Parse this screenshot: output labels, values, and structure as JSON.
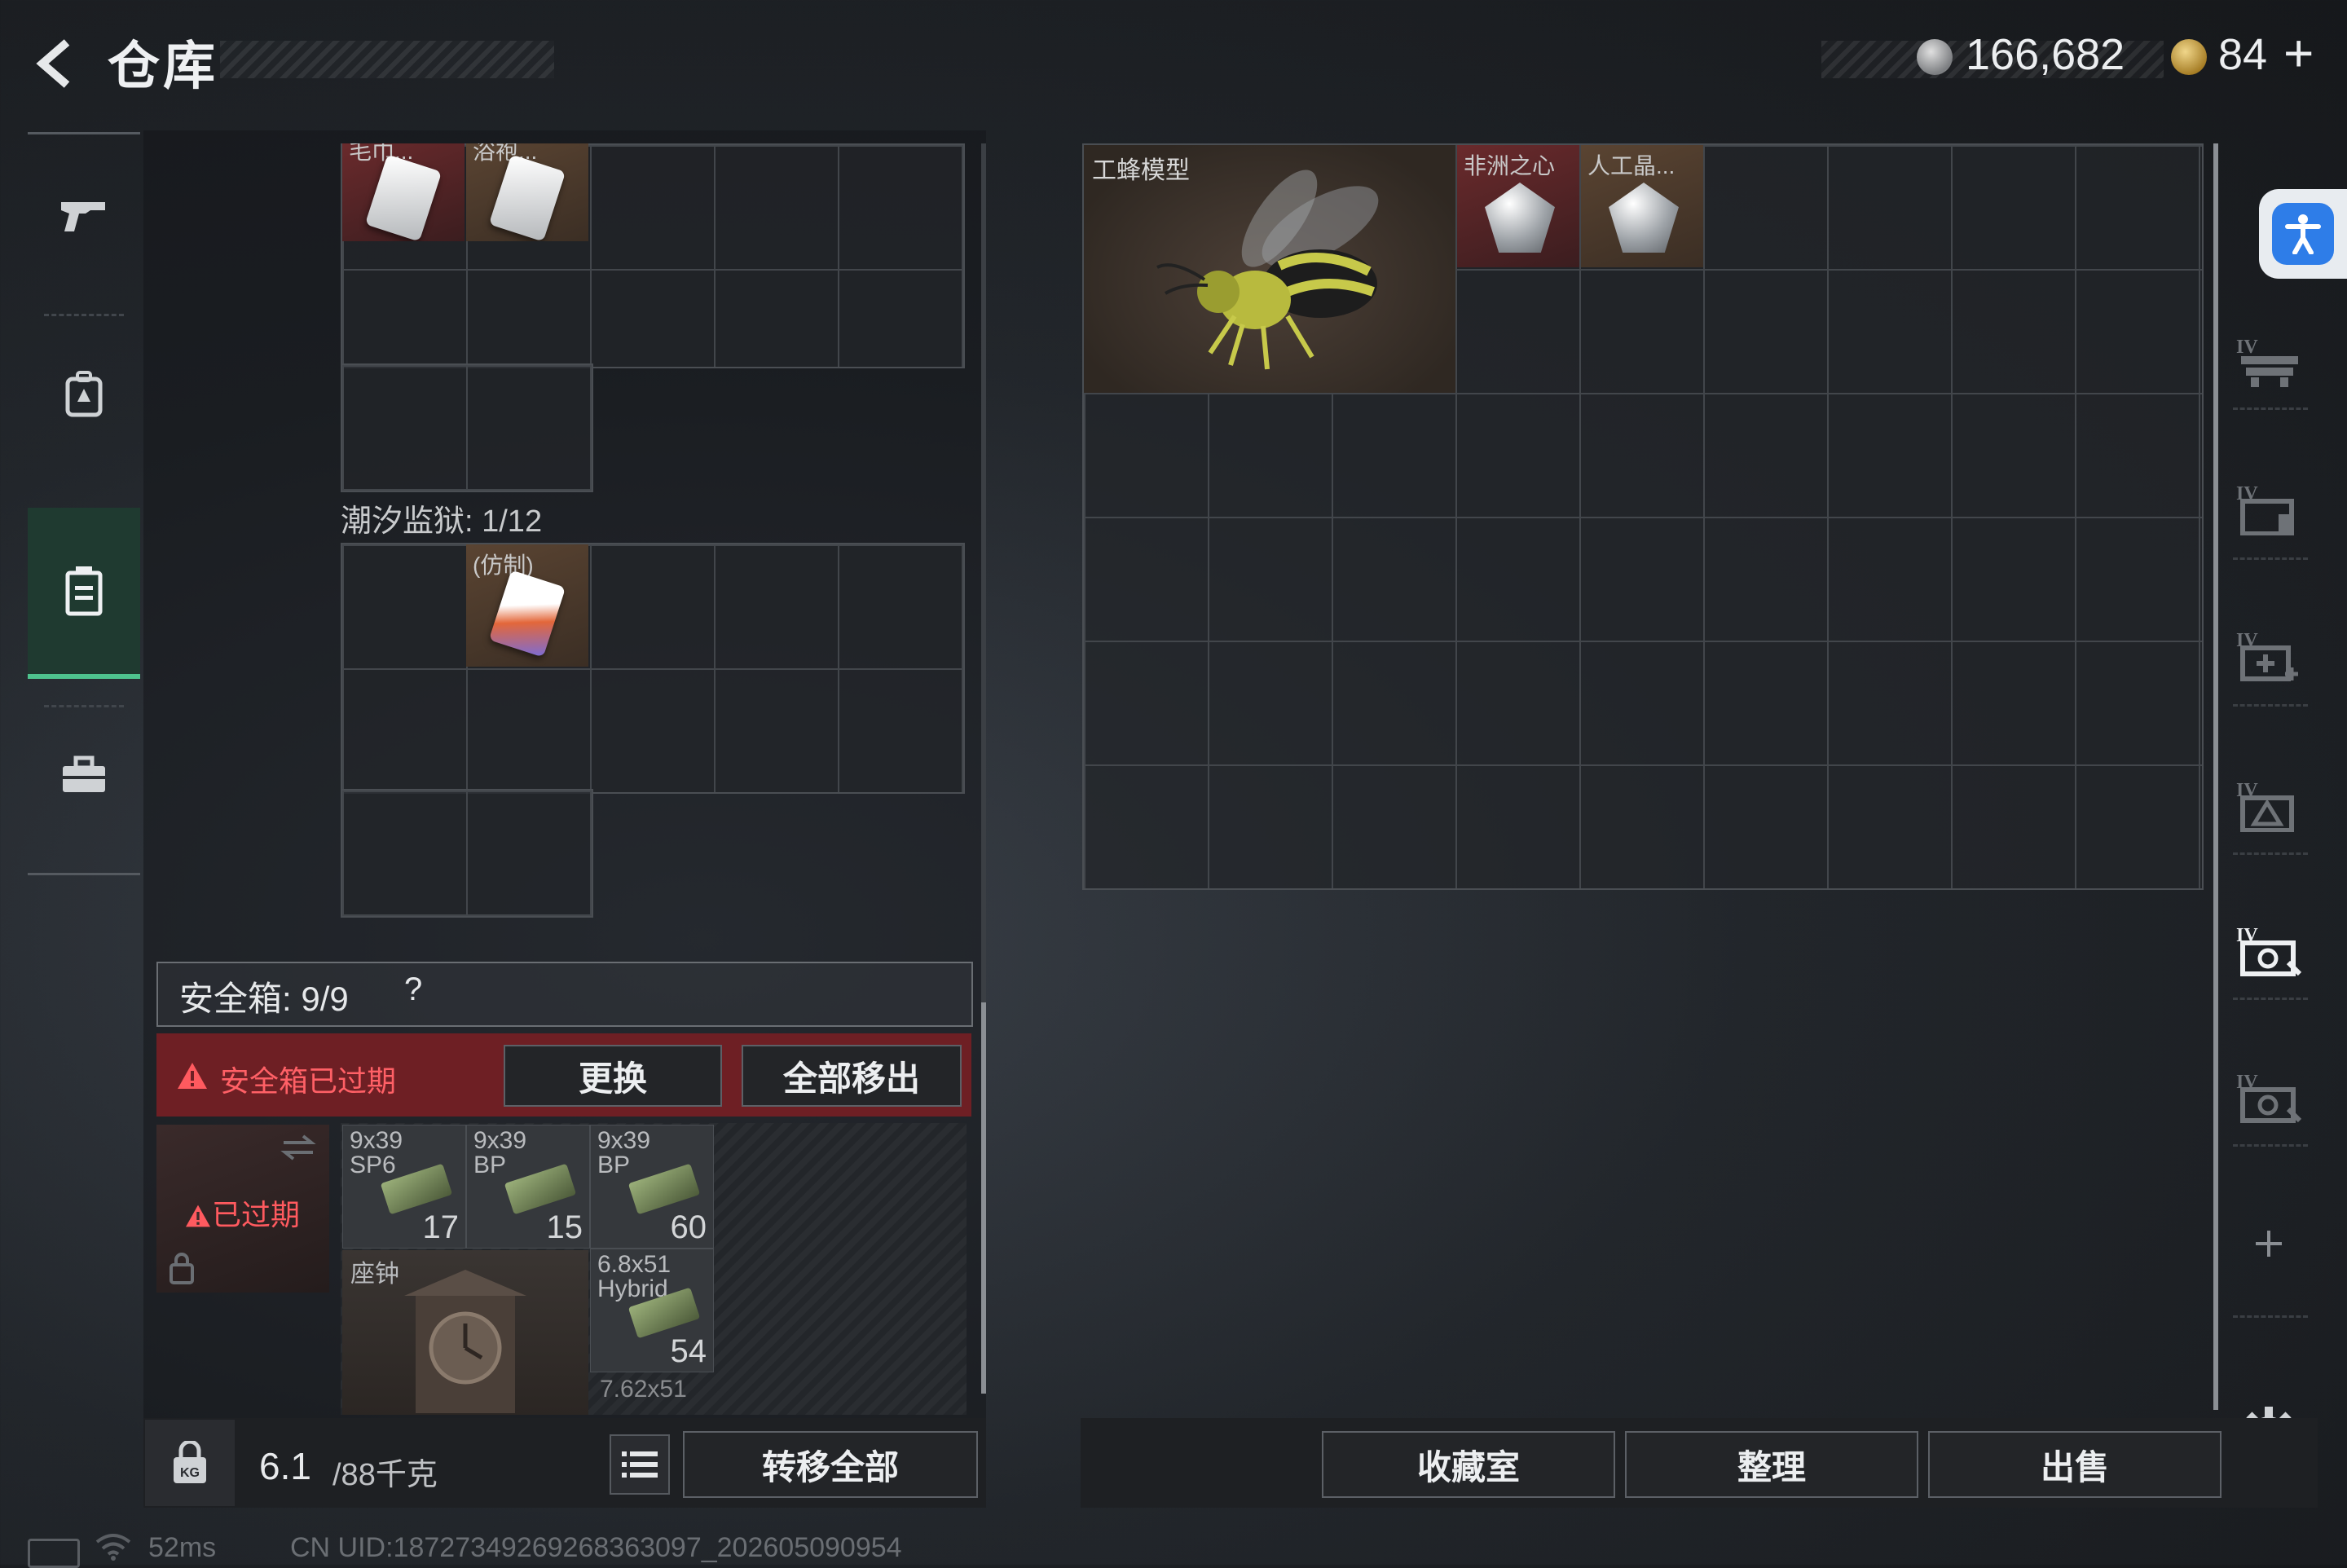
{
  "header": {
    "title": "仓库",
    "currency1": "166,682",
    "currency2": "84",
    "currency2_plus": "+"
  },
  "left_nav": {
    "items": [
      "gun-icon",
      "backpack-icon",
      "storage-icon",
      "toolbox-icon"
    ],
    "active": "storage-icon"
  },
  "storage": {
    "top_items": [
      "毛巾...",
      "浴袍..."
    ],
    "tide_prison_label": "潮汐监狱: 1/12",
    "tide_item_label": "(仿制)"
  },
  "safe_box": {
    "title": "安全箱: 9/9",
    "help": "?",
    "expired_warning": "安全箱已过期",
    "replace_label": "更换",
    "remove_all_label": "全部移出",
    "expired_tag": "已过期",
    "items": [
      {
        "caliber": "9x39\nSP6",
        "count": "17"
      },
      {
        "caliber": "9x39\nBP",
        "count": "15"
      },
      {
        "caliber": "9x39\nBP",
        "count": "60"
      },
      {
        "caliber": "6.8x51\nHybrid",
        "count": "54"
      }
    ],
    "clock_label": "座钟",
    "partial_label": "7.62x51"
  },
  "bottom_left": {
    "weight": "6.1",
    "weight_max": "/88千克",
    "transfer_all_label": "转移全部"
  },
  "stash": {
    "bee_label": "工蜂模型",
    "gem1_label": "非洲之心",
    "gem2_label": "人工晶..."
  },
  "side_icons": [
    "tier4-rack-icon",
    "tier4-case-icon",
    "tier4-medkit-icon",
    "tier4-ammo-icon",
    "tier4-gear-icon",
    "tier4-toolcase-icon",
    "add-icon"
  ],
  "bottom_right": {
    "collection_label": "收藏室",
    "organize_label": "整理",
    "sell_label": "出售"
  },
  "status_bar": {
    "ping": "52ms",
    "uid": "CN UID:18727349269268363097_202605090954"
  },
  "colors": {
    "accent_green": "#4ec38e",
    "danger_red": "#ff6066",
    "expired_bg": "#6e1f24",
    "item_red": "#6a2a2c",
    "item_tan": "#5a4432"
  }
}
